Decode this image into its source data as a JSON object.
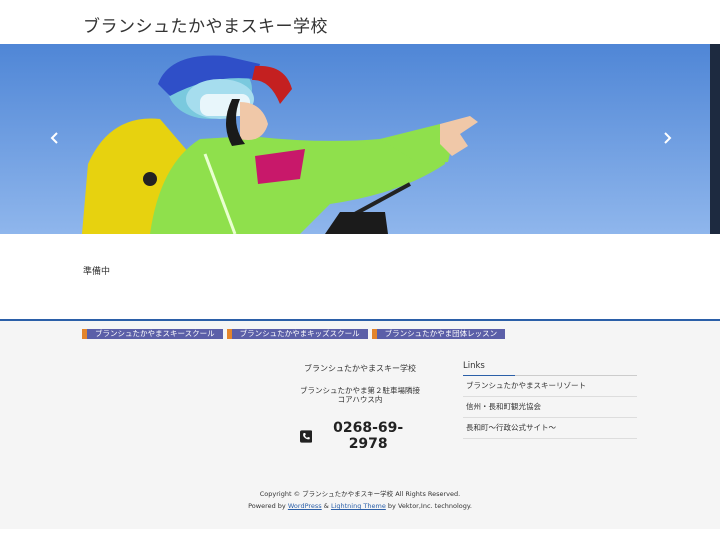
{
  "header": {
    "site_title": "ブランシュたかやまスキー学校"
  },
  "content": {
    "body_text": "準備中"
  },
  "footer": {
    "nav": [
      {
        "label": "ブランシュたかやまスキースクール"
      },
      {
        "label": "ブランシュたかやまキッズスクール"
      },
      {
        "label": "ブランシュたかやま団体レッスン"
      }
    ],
    "contact": {
      "name": "ブランシュたかやまスキー学校",
      "address_line1": "ブランシュたかやま第２駐車場隣接",
      "address_line2": "コアハウス内",
      "phone": "0268-69-2978"
    },
    "links": {
      "title": "Links",
      "items": [
        {
          "label": "ブランシュたかやまスキーリゾート"
        },
        {
          "label": "信州・長和町観光協会"
        },
        {
          "label": "長和町〜行政公式サイト〜"
        }
      ]
    },
    "copyright": "Copyright © ブランシュたかやまスキー学校 All Rights Reserved.",
    "powered": {
      "prefix": "Powered by",
      "wordpress": "WordPress",
      "amp": "&",
      "theme": "Lightning Theme",
      "suffix": "by Vektor,Inc. technology."
    }
  },
  "colors": {
    "footer_accent": "#2b5fa8",
    "nav_label_bg": "#5b5fa8",
    "nav_marker": "#e4852c"
  },
  "icons": {
    "prev": "chevron-left-icon",
    "next": "chevron-right-icon",
    "phone": "phone-icon"
  }
}
